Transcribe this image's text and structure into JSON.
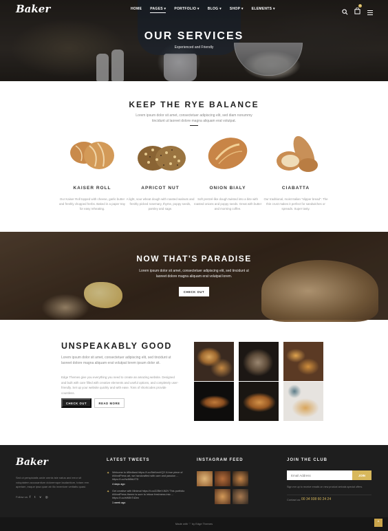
{
  "header": {
    "logo": "Baker",
    "nav": [
      "HOME",
      "PAGES",
      "PORTFOLIO",
      "BLOG",
      "SHOP",
      "ELEMENTS"
    ],
    "cart_count": "0"
  },
  "hero": {
    "title": "OUR SERVICES",
    "subtitle": "Experienced and Friendly"
  },
  "rye": {
    "title": "KEEP THE RYE BALANCE",
    "text": "Lorem ipsum dolor sit amet, consectetuer adipiscing elit, sed diam nonummy tincidunt ut laoreet dolore magna aliquam erat volutpat.",
    "items": [
      {
        "name": "KAISER ROLL",
        "desc": "Our Kaiser Roll topped with cheese, garlic butter and freshly chopped herbs. Baked in a paper tray for easy reheating."
      },
      {
        "name": "APRICOT NUT",
        "desc": "A light, sour wheat dough with roasted walnuts and freshly picked rosemary, thyme, poppy seeds, parsley and sage."
      },
      {
        "name": "ONION BIALY",
        "desc": "Soft pretzel-like dough twisted into a bite with roasted onions and poppy seeds. Great with butter and morning coffee."
      },
      {
        "name": "CIABATTA",
        "desc": "Our traditional, moist Italian \"slipper bread\". The thin crust makes it perfect for sandwiches or spreads. Super tasty."
      }
    ]
  },
  "paradise": {
    "title": "NOW THAT'S PARADISE",
    "text": "Lorem ipsum dolor sit amet, consectetuer adipiscing elit, sed tincidunt ut laoreet dolore magna aliquam erat volutpat lorem.",
    "button": "CHECK OUT"
  },
  "good": {
    "title": "UNSPEAKABLY GOOD",
    "text": "Lorem ipsum dolor sit amet, consectetuer adipiscing elit, sed tincidunt ut laoreet dolore magna aliquam erat volutpat lorem ipsum dolor sit.",
    "text2": "Edge Themes give you everything you need to create an amazing website. Designed and built with care filled with creative elements and useful options, and completely user-friendly. Set up your website quickly and with ease. Tons of shortcodes provide countless.",
    "btn_primary": "CHECK OUT",
    "btn_secondary": "READ MORE"
  },
  "footer": {
    "logo": "Baker",
    "about": "Sed ut perspiciatis unde omnis iste natus and error sit voluptatem accusantium doloremque laudantium, totam rem aperiam, eaque ipsa quae ab illo inventore veritatis quasi.",
    "follow": "Follow us:",
    "tweets_title": "LATEST TWEETS",
    "tweets": [
      {
        "text": "Welcome to #Birdland https://t.co/5ixKmnKQY A true piece of #WordPress art, we handcrafted with care and passion ... https://t.co/hv8t5tkXTD",
        "time": "4 days ago"
      },
      {
        "text": "Get creative with Minimal https://t.co/ZZBeVJ62V This portfolio #WordPress theme is sure to infuse freshness into ... https://t.co/eW8hTd2en",
        "time": "1 week ago"
      }
    ],
    "insta_title": "INSTAGRAM FEED",
    "club_title": "JOIN THE CLUB",
    "email_placeholder": "Email Address",
    "join": "JOIN",
    "signup": "Sign me up to receive emails on new product arrivals special offers.",
    "contact_label": "Contact us:",
    "contact_phone": "00 34 938 60 24 24",
    "copyright": "Made with ♡ by Edge Themes"
  },
  "colors": {
    "accent": "#d8b85c",
    "dark": "#1e1e1e"
  }
}
